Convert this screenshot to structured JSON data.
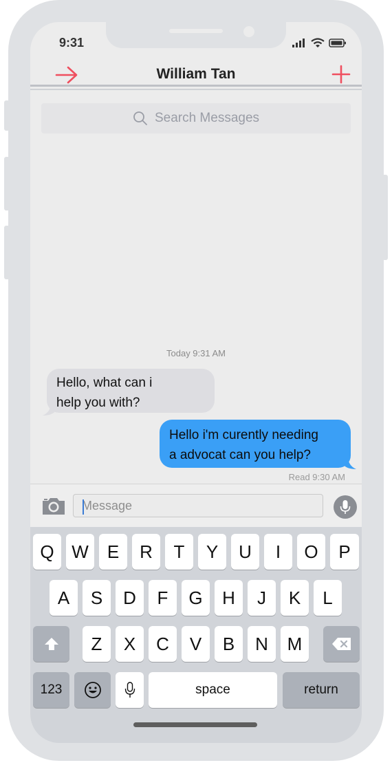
{
  "status_bar": {
    "time": "9:31"
  },
  "header": {
    "title": "William Tan"
  },
  "search": {
    "placeholder": "Search Messages"
  },
  "conversation": {
    "timestamp": "Today 9:31 AM",
    "messages": [
      {
        "direction": "incoming",
        "line1": "Hello, what can i",
        "line2": "help you with?"
      },
      {
        "direction": "outgoing",
        "line1": "Hello i'm curently needing",
        "line2": "a advocat can you help?"
      }
    ],
    "read_receipt": "Read 9:30 AM"
  },
  "input": {
    "placeholder": "Message"
  },
  "keyboard": {
    "row1": [
      "Q",
      "W",
      "E",
      "R",
      "T",
      "Y",
      "U",
      "I",
      "O",
      "P"
    ],
    "row2": [
      "A",
      "S",
      "D",
      "F",
      "G",
      "H",
      "J",
      "K",
      "L"
    ],
    "row3": [
      "Z",
      "X",
      "C",
      "V",
      "B",
      "N",
      "M"
    ],
    "numbers_key": "123",
    "space_key": "space",
    "return_key": "return"
  },
  "colors": {
    "accent_red": "#ef4f5f",
    "outgoing_bubble": "#3a9ff6",
    "incoming_bubble": "#dddde1"
  },
  "icons": [
    "arrow-right-icon",
    "plus-icon",
    "search-icon",
    "camera-icon",
    "mic-icon",
    "shift-icon",
    "delete-icon",
    "emoji-icon",
    "dictation-icon",
    "signal-icon",
    "wifi-icon",
    "battery-icon"
  ]
}
